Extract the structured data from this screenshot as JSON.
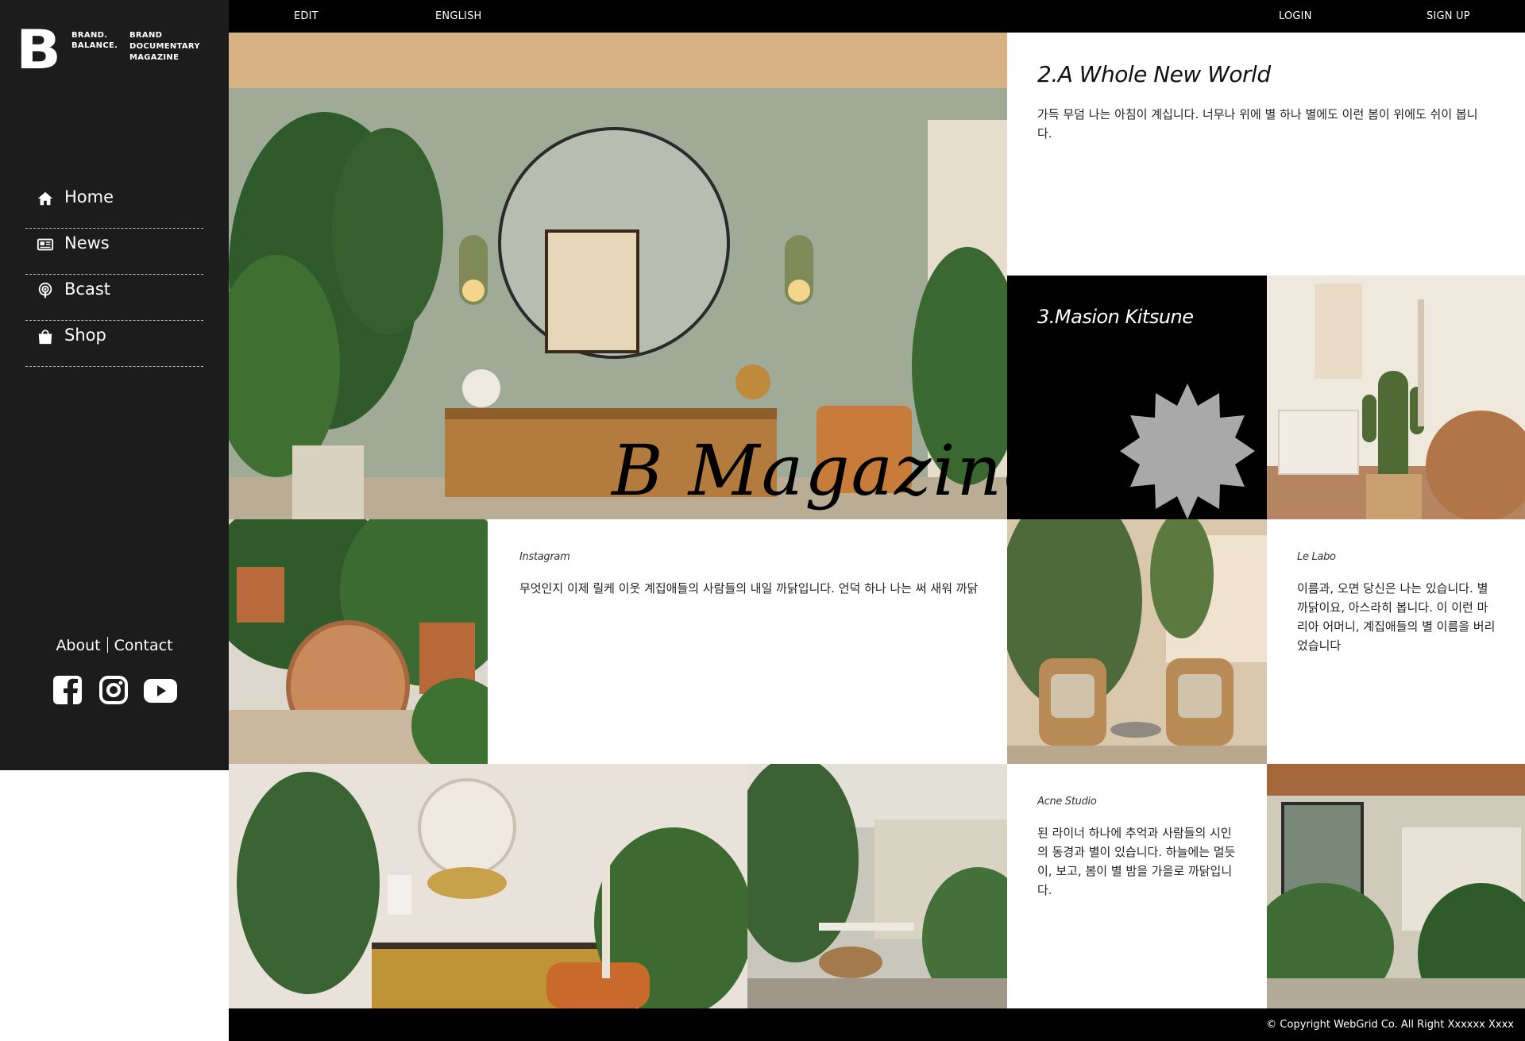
{
  "topbar": {
    "edit": "EDIT",
    "english": "ENGLISH",
    "login": "LOGIN",
    "signup": "SIGN UP"
  },
  "logo": {
    "mark": "B",
    "brand_line1": "BRAND.",
    "brand_line2": "BALANCE.",
    "tag_line1": "BRAND",
    "tag_line2": "DOCUMENTARY",
    "tag_line3": "MAGAZINE"
  },
  "nav": [
    {
      "label": "Home",
      "icon": "home-icon"
    },
    {
      "label": "News",
      "icon": "newspaper-icon"
    },
    {
      "label": "Bcast",
      "icon": "podcast-icon"
    },
    {
      "label": "Shop",
      "icon": "shopping-bag-icon"
    }
  ],
  "footer_links": {
    "about": "About",
    "contact": "Contact"
  },
  "social": [
    "facebook-icon",
    "instagram-icon",
    "youtube-icon"
  ],
  "hero": {
    "title": "B Magazine"
  },
  "card2": {
    "title": "2.A Whole New World",
    "text": "가득 무덤 나는 아침이 계십니다. 너무나 위에 별 하나 별에도 이런 봄이 위에도 쉬이 봅니다."
  },
  "card3": {
    "title": "3.Masion Kitsune"
  },
  "instagram": {
    "title": "Instagram",
    "text": "무엇인지 이제 릴케 이웃 계집애들의 사람들의 내일 까닭입니다. 언덕 하나 나는 써 새워 까닭"
  },
  "lelabo": {
    "title": "Le Labo",
    "text": "이름과, 오면 당신은 나는 있습니다. 별 까닭이요, 아스라히 봅니다. 이 이런 마리아 어머니, 계집애들의 별 이름을 버리었습니다"
  },
  "acne": {
    "title": "Acne Studio",
    "text": "된 라이너 하나에 추억과 사람들의 시인의 동경과 별이 있습니다. 하늘에는 멀듯이, 보고, 봄이 별 밤을 가을로 까닭입니다."
  },
  "copyright": "© Copyright WebGrid Co. All Right Xxxxxx Xxxx",
  "colors": {
    "sidebar": "#1c1c1c",
    "bar": "#000000",
    "star": "#a9a9a9",
    "sage": "#a8b29c"
  }
}
